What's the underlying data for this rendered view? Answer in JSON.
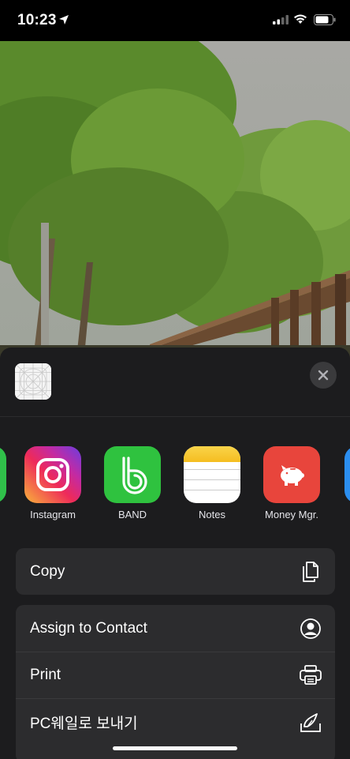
{
  "status_bar": {
    "time": "10:23"
  },
  "share_sheet": {
    "apps": [
      {
        "label": "Instagram",
        "icon": "instagram-icon"
      },
      {
        "label": "BAND",
        "icon": "band-icon"
      },
      {
        "label": "Notes",
        "icon": "notes-icon"
      },
      {
        "label": "Money Mgr.",
        "icon": "piggy-bank-icon"
      }
    ],
    "actions_primary": [
      {
        "label": "Copy",
        "icon": "copy-icon"
      }
    ],
    "actions_secondary": [
      {
        "label": "Assign to Contact",
        "icon": "contact-icon"
      },
      {
        "label": "Print",
        "icon": "printer-icon"
      },
      {
        "label": "PC웨일로 보내기",
        "icon": "whale-send-icon"
      }
    ]
  },
  "colors": {
    "sheet_bg": "#1c1c1e",
    "row_bg": "#2c2c2e",
    "band_green": "#2fc23f",
    "money_red": "#e8453c",
    "notes_yellow": "#f7c52b"
  }
}
